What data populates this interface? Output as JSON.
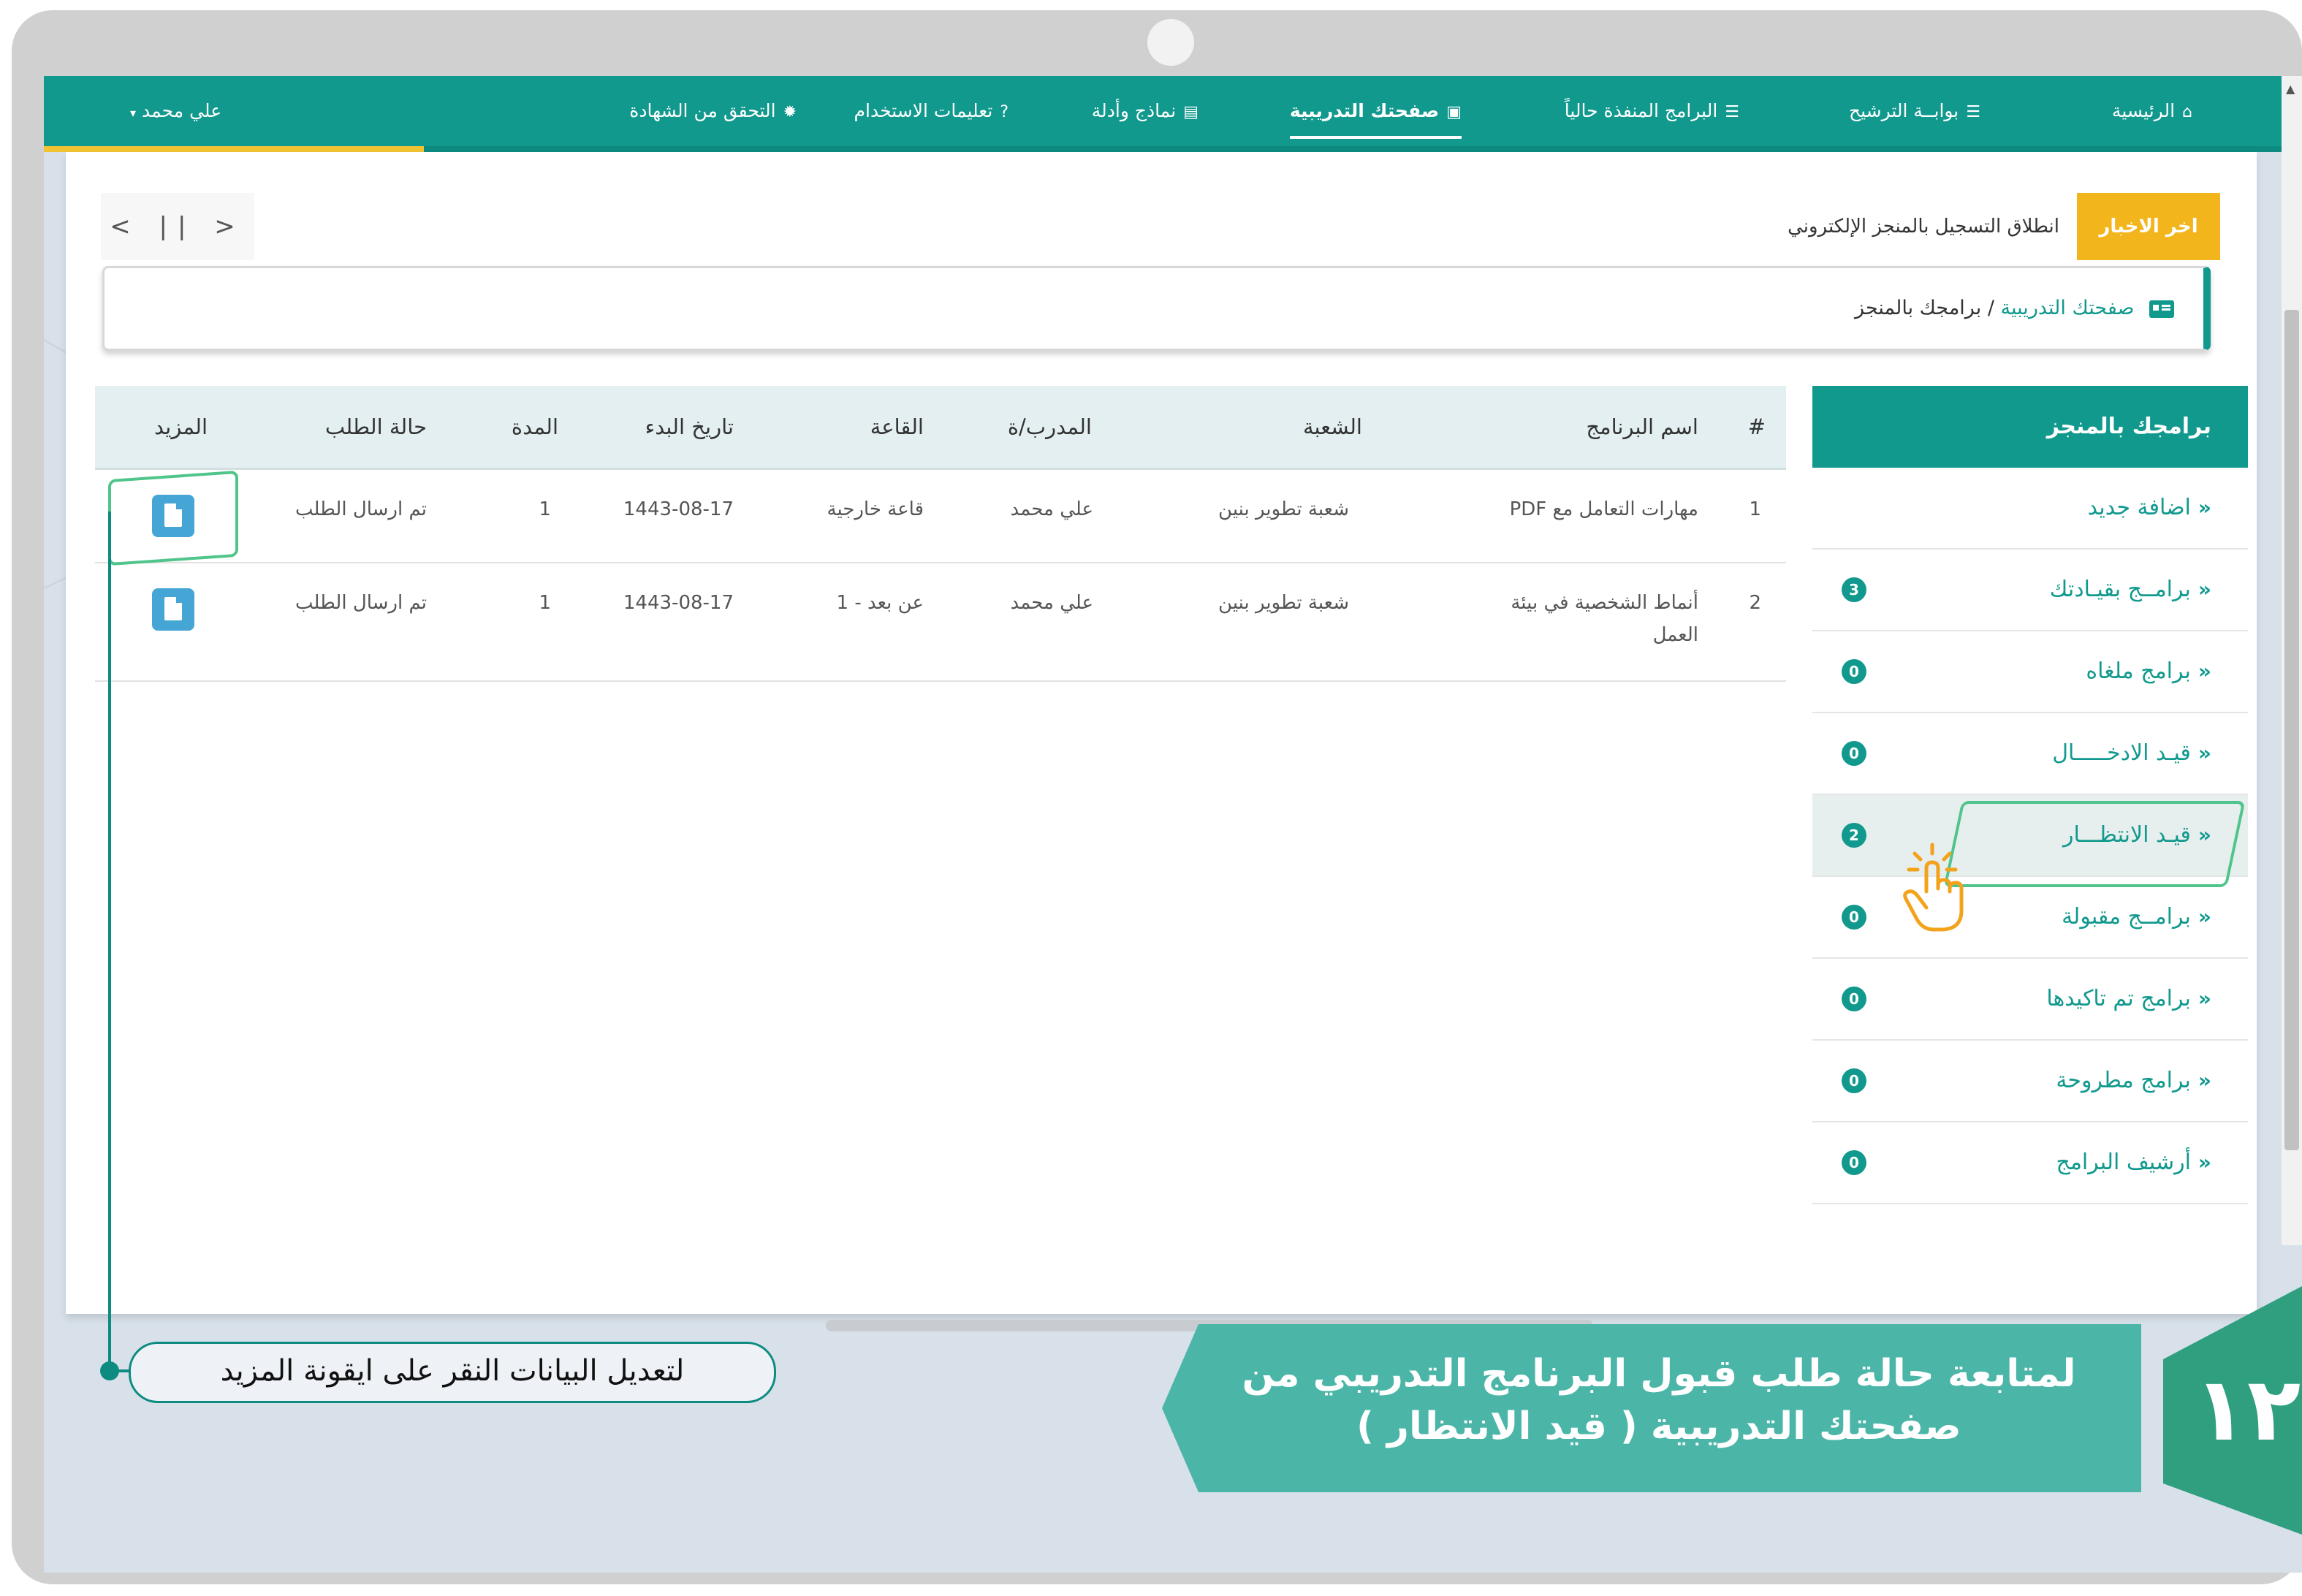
{
  "nav": {
    "items": [
      {
        "label": "الرئيسية",
        "icon": "home-icon"
      },
      {
        "label": "بوابــة الترشيح",
        "icon": "list-icon"
      },
      {
        "label": "البرامج المنفذة حالياً",
        "icon": "list-icon"
      },
      {
        "label": "صفحتك التدريبية",
        "icon": "id-badge-icon",
        "active": true
      },
      {
        "label": "نماذج وأدلة",
        "icon": "file-icon"
      },
      {
        "label": "تعليمات الاستخدام",
        "icon": "question-icon"
      },
      {
        "label": "التحقق من الشهادة",
        "icon": "certificate-icon"
      }
    ],
    "user": "علي محمد"
  },
  "news": {
    "title": "اخر الاخبار",
    "text": "انطلاق التسجيل بالمنجز الإلكتروني",
    "controls": "<  ||  >"
  },
  "breadcrumb": {
    "link": "صفحتك التدريبية",
    "separator": "/",
    "current": "برامجك بالمنجز"
  },
  "sidebar": {
    "title": "برامجك بالمنجز",
    "items": [
      {
        "label": "اضافة جديد",
        "count": null
      },
      {
        "label": "برامــج بقيـادتك",
        "count": "3"
      },
      {
        "label": "برامج ملغاه",
        "count": "0"
      },
      {
        "label": "قيـد الادخـــــال",
        "count": "0"
      },
      {
        "label": "قيـد الانتظـــار",
        "count": "2"
      },
      {
        "label": "برامــج مقبولة",
        "count": "0"
      },
      {
        "label": "برامج تم تاكيدها",
        "count": "0"
      },
      {
        "label": "برامج مطروحة",
        "count": "0"
      },
      {
        "label": "أرشيف البرامج",
        "count": "0"
      }
    ]
  },
  "table": {
    "headers": {
      "num": "#",
      "program": "اسم البرنامج",
      "branch": "الشعبة",
      "trainer": "المدرب/ة",
      "hall": "القاعة",
      "start_date": "تاريخ البدء",
      "duration": "المدة",
      "status": "حالة الطلب",
      "more": "المزيد"
    },
    "rows": [
      {
        "num": "1",
        "program": "مهارات التعامل مع PDF",
        "program_line2": "",
        "branch": "شعبة تطوير بنين",
        "trainer": "علي محمد",
        "hall": "قاعة خارجية",
        "start_date": "1443-08-17",
        "duration": "1",
        "status": "تم ارسال الطلب"
      },
      {
        "num": "2",
        "program": "أنماط الشخصية في بيئة",
        "program_line2": "العمل",
        "branch": "شعبة تطوير بنين",
        "trainer": "علي محمد",
        "hall": "عن بعد - 1",
        "start_date": "1443-08-17",
        "duration": "1",
        "status": "تم ارسال الطلب"
      }
    ]
  },
  "annotation": {
    "callout": "لتعديل البيانات النقر على ايقونة المزيد",
    "banner_line1": "لمتابعة حالة طلب قبول البرنامج التدريبي من",
    "banner_line2": "صفحتك التدريبية ( قيد الانتظار )",
    "step": "١٢"
  },
  "colors": {
    "primary": "#11998e",
    "news_badge": "#f3b51c",
    "highlight_box": "#4fc58b",
    "banner": "#4bb6a8",
    "file_button": "#45a6d6"
  }
}
